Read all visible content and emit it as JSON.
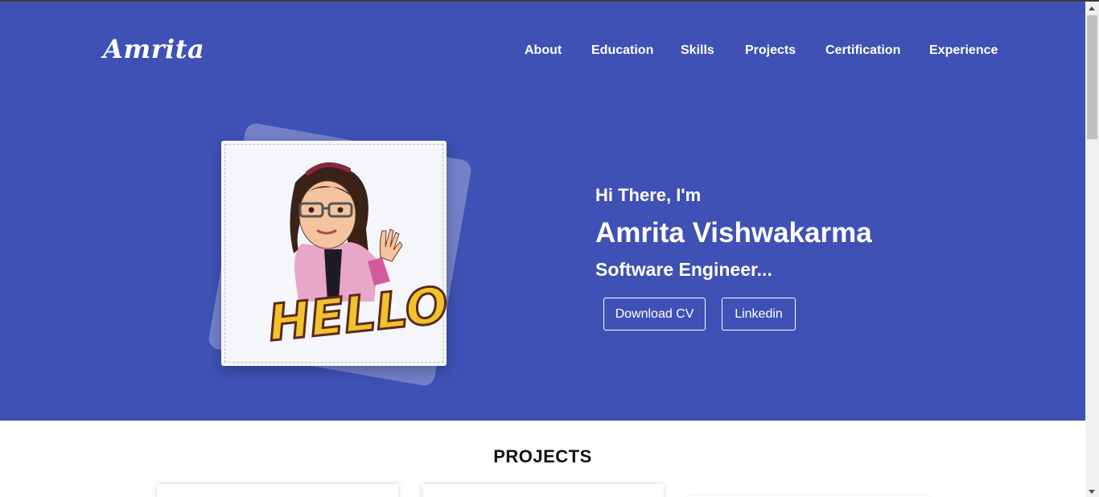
{
  "brand": {
    "logo_text": "Amrita"
  },
  "nav": {
    "items": [
      {
        "label": "About"
      },
      {
        "label": "Education"
      },
      {
        "label": "Skills"
      },
      {
        "label": "Projects"
      },
      {
        "label": "Certification"
      },
      {
        "label": "Experience"
      }
    ]
  },
  "hero": {
    "greeting": "Hi There, I'm",
    "name": "Amrita Vishwakarma",
    "role": "Software Engineer...",
    "avatar": {
      "caption_text": "HELLO",
      "icon": "cartoon-avatar-waving"
    },
    "buttons": {
      "download_cv": "Download CV",
      "linkedin": "Linkedin"
    }
  },
  "projects": {
    "title": "PROJECTS"
  },
  "colors": {
    "hero_background": "#3f51b5",
    "text_on_hero": "#ffffff",
    "avatar_caption_fill": "#f2c12e"
  }
}
